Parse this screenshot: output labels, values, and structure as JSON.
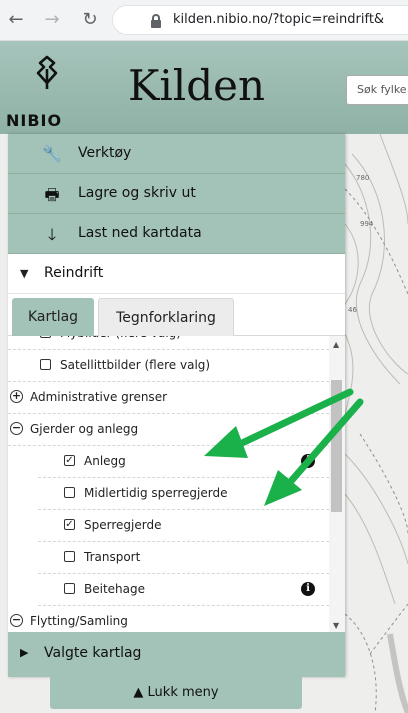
{
  "browser": {
    "back_icon": "←",
    "forward_icon": "→",
    "reload_icon": "↻",
    "url": "kilden.nibio.no/?topic=reindrift&"
  },
  "header": {
    "logo_text": "NIBIO",
    "title": "Kilden",
    "search_placeholder": "Søk fylke"
  },
  "menu": {
    "tools": [
      {
        "icon": "wrench-icon",
        "glyph": "🔧",
        "label": "Verktøy"
      },
      {
        "icon": "printer-icon",
        "glyph": "🖶",
        "label": "Lagre og skriv ut"
      },
      {
        "icon": "download-arrow-icon",
        "glyph": "🡓",
        "label": "Last ned kartdata"
      }
    ],
    "section": {
      "caret": "▼",
      "label": "Reindrift"
    },
    "tabs": {
      "active": "Kartlag",
      "inactive": "Tegnforklaring"
    },
    "tree": [
      {
        "kind": "checkbox",
        "level": 0,
        "checked": false,
        "label": "Flybilder (flere valg)"
      },
      {
        "kind": "checkbox",
        "level": 0,
        "checked": false,
        "label": "Satellittbilder (flere valg)"
      },
      {
        "kind": "group",
        "level": 0,
        "expanded": false,
        "label": "Administrative grenser"
      },
      {
        "kind": "group",
        "level": 0,
        "expanded": true,
        "label": "Gjerder og anlegg"
      },
      {
        "kind": "checkbox",
        "level": 1,
        "checked": true,
        "label": "Anlegg",
        "info": true
      },
      {
        "kind": "checkbox",
        "level": 1,
        "checked": false,
        "label": "Midlertidig sperregjerde"
      },
      {
        "kind": "checkbox",
        "level": 1,
        "checked": true,
        "label": "Sperregjerde"
      },
      {
        "kind": "checkbox",
        "level": 1,
        "checked": false,
        "label": "Transport"
      },
      {
        "kind": "checkbox",
        "level": 1,
        "checked": false,
        "label": "Beitehage",
        "info": true
      },
      {
        "kind": "group",
        "level": 0,
        "expanded": true,
        "label": "Flytting/Samling"
      }
    ],
    "selected_layers": {
      "caret": "▶",
      "label": "Valgte kartlag"
    },
    "close_button": "▲ Lukk meny"
  },
  "map": {
    "labels": [
      "780",
      "994",
      "46"
    ]
  },
  "colors": {
    "menu_green": "#a3c2b8",
    "arrow_green": "#1ab04a"
  }
}
